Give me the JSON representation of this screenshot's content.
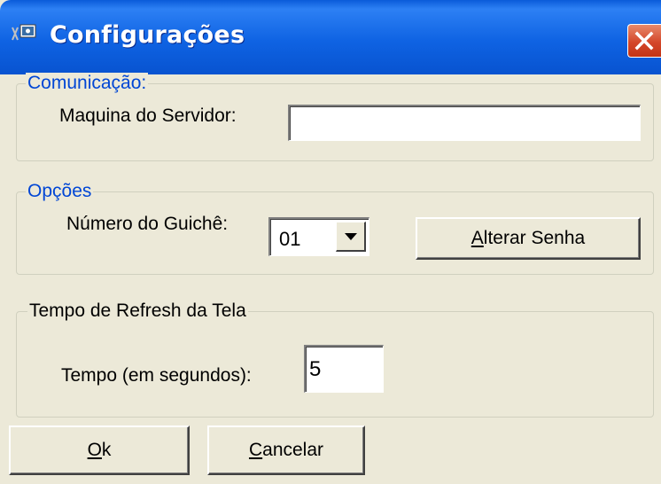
{
  "window": {
    "title": "Configurações"
  },
  "comunicacao": {
    "legend": "Comunicação:",
    "servidor_label": "Maquina do Servidor:",
    "servidor_value": ""
  },
  "opcoes": {
    "legend": "Opções",
    "guiche_label": "Número do Guichê:",
    "guiche_value": "01",
    "alterar_senha": {
      "mnemonic": "A",
      "rest": "lterar Senha"
    }
  },
  "refresh": {
    "legend": "Tempo de Refresh da Tela",
    "tempo_label": "Tempo (em segundos):",
    "tempo_value": "5"
  },
  "buttons": {
    "ok": {
      "mnemonic": "O",
      "rest": "k"
    },
    "cancelar": {
      "mnemonic": "C",
      "rest": "ancelar"
    }
  },
  "colors": {
    "titlebar": "#0a5bd9",
    "legend_text": "#0046d5",
    "dialog_bg": "#ece9d8",
    "close_button": "#d4472a"
  },
  "icons": {
    "title": "app-icon",
    "close": "close-icon",
    "combo": "chevron-down-icon"
  }
}
